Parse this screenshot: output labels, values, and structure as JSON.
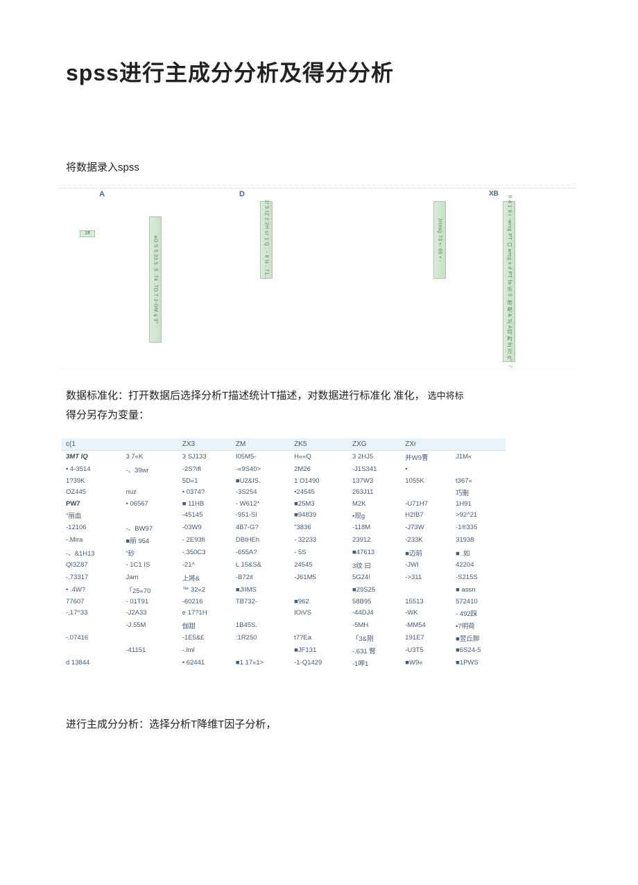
{
  "title": "spss进行主成分分析及得分分析",
  "step1": "将数据录入spss",
  "spss_sheet": {
    "header_A": "A",
    "header_D": "D",
    "header_XB": "XB",
    "row_label": "1ff",
    "col1_text": "aO.S 5 33.5 .5 .T4 .TO.T 3-OM.q 3\"",
    "col2_text": "2/.5 tZ 2.2H cr 1 Q . - 9 ls ..71…",
    "col3_text": "Jrtnsg  73 •-   05 • -",
    "col4_text": "fl 4 1 9 r -wrcg PT 口 wrcg s d PT fa-币 3 .而 吧 & Sj A切 旳 bj 万 g\" 『"
  },
  "step2_line1": "数据标准化：打开数据后选择分析T描述统计T描述，对数据进行标准化 准化，",
  "step2_suffix": "选中将标",
  "step2_line2": "得分另存为变量：",
  "ztable": {
    "headers": [
      "c(1",
      "",
      "ZX3",
      "ZM",
      "ZK5",
      "ZXG",
      "ZXr",
      ""
    ],
    "rows": [
      [
        "3MT IQ",
        "3 7«K",
        "3 SJ133",
        "I05M5-",
        "H««Q",
        "3 2HJ5",
        "并W9曹",
        "J1M«"
      ],
      [
        "• 4-3514",
        "-、39wr",
        "-2S?ifl",
        "-«9S40>",
        "2M26",
        "-J1S341",
        "•",
        ""
      ],
      [
        "1?39K",
        "",
        "5D«1",
        "■U2&IS.",
        "1 O1490",
        "137W3",
        "1055K",
        "t367«"
      ],
      [
        "OZ445",
        "nuz",
        "• 0374?",
        "-3S254",
        "•24545",
        "263J11",
        "",
        "巧刪"
      ],
      [
        "PW7",
        "• 06567",
        "■ 11HB",
        "- W612*",
        "■25M3",
        "M2K",
        "-U71H7",
        "1H91"
      ],
      [
        "\"丽血",
        "",
        "-45145",
        "-951-SI",
        "■94839",
        "•现g",
        "H2IB7",
        ">92^21"
      ],
      [
        "-12106",
        "-、BW97",
        "-03W9",
        "4B7-G?",
        "\"3836",
        "-118M",
        "-J73W",
        "-1®335"
      ],
      [
        "-.Mira",
        "■丽   954",
        "- 2E93fi",
        "DBtHEh",
        "- 32233",
        "23912",
        "-233K",
        "31938"
      ],
      [
        "-、&1H13",
        "\"砂",
        "-.350C3",
        "-655A?",
        "- 5S",
        "■47613",
        "■迈前",
        "■ .如"
      ],
      [
        "QI3Z87",
        "- 1C1 IS",
        "-21^",
        "L 15&S&",
        "24545",
        "3纹 曰",
        "-JWI",
        "42204"
      ],
      [
        "-.73317",
        "Jam",
        "上將&",
        "-B72it",
        "-J61M5",
        "5G24!",
        "->311",
        "-S215S"
      ],
      [
        "• .4W?",
        "「25«70",
        "™ 32«2",
        "■JIIMS",
        "",
        "■29S25",
        "",
        "■ assn"
      ],
      [
        "77607",
        "- 01T91",
        "-60216",
        "TB732-",
        "■962",
        "58B95",
        "15513",
        "572410"
      ],
      [
        "-,17^33",
        "-J2A33",
        "e 17?1H",
        "",
        "IOiVS",
        "-44DJ4",
        "-WK",
        "- 492踩"
      ],
      [
        "",
        "-J.55M",
        "伽甜",
        "1B45S.",
        "",
        "-5MH",
        "-MM54",
        "•7明荷"
      ],
      [
        "-.07416",
        "",
        "-1E5&£",
        ":1R250",
        "t7?Ea",
        "「3&刚",
        "191E7",
        "■翌丘脚"
      ],
      [
        "",
        "-41151",
        "-.lml",
        "",
        "■JF131",
        "-.631 腎",
        "-U3T5",
        "■6S24-5"
      ],
      [
        "d 13844",
        "",
        "• 62441",
        "■1 17«1>",
        "-1-Q1429",
        "-1呷1",
        "■W9«",
        "■1PWS"
      ]
    ]
  },
  "step3": "进行主成分分析：选择分析T降维T因子分析，"
}
